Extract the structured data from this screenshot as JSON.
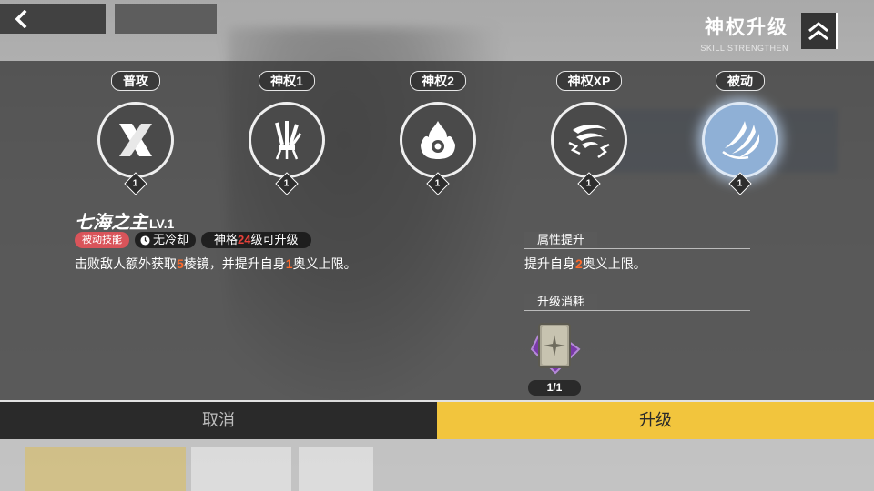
{
  "header": {
    "title": "神权升级",
    "subtitle": "SKILL STRENGTHEN"
  },
  "skills": [
    {
      "label": "普攻",
      "level": "1",
      "icon": "cross-blades-icon"
    },
    {
      "label": "神权1",
      "level": "1",
      "icon": "weapons-bundle-icon"
    },
    {
      "label": "神权2",
      "level": "1",
      "icon": "flame-orb-icon"
    },
    {
      "label": "神权XP",
      "level": "1",
      "icon": "whirlwind-lightning-icon"
    },
    {
      "label": "被动",
      "level": "1",
      "icon": "claw-slash-icon"
    }
  ],
  "selected_skill": {
    "name": "七海之主",
    "level": "LV.1",
    "tag_type": "被动技能",
    "cooldown": "无冷却",
    "requirement_prefix": "神格",
    "requirement_num": "24",
    "requirement_suffix": "级可升级",
    "desc_part1": "击败敌人额外获取",
    "desc_num1": "5",
    "desc_part2": "棱镜，并提升自身",
    "desc_num2": "1",
    "desc_part3": "奥义上限。"
  },
  "attribute": {
    "heading": "属性提升",
    "text_part1": "提升自身",
    "text_num": "2",
    "text_part2": "奥义上限。"
  },
  "cost": {
    "heading": "升级消耗",
    "item_icon": "skill-book-icon",
    "count": "1/1"
  },
  "buttons": {
    "cancel": "取消",
    "upgrade": "升级"
  },
  "colors": {
    "accent_yellow": "#f2c53d",
    "highlight_orange": "#ff6a2a",
    "tag_red": "#d9545a",
    "active_skill_blue": "#8fb0d6"
  }
}
